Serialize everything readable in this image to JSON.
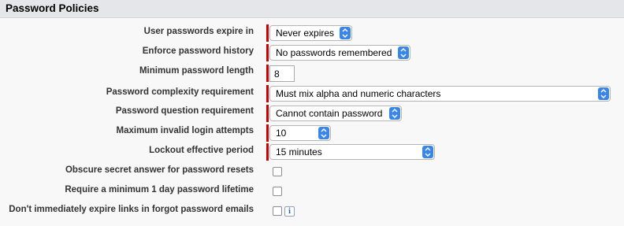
{
  "section": {
    "title": "Password Policies"
  },
  "fields": {
    "expire": {
      "label": "User passwords expire in",
      "value": "Never expires"
    },
    "history": {
      "label": "Enforce password history",
      "value": "No passwords remembered"
    },
    "min_length": {
      "label": "Minimum password length",
      "value": "8"
    },
    "complexity": {
      "label": "Password complexity requirement",
      "value": "Must mix alpha and numeric characters"
    },
    "question": {
      "label": "Password question requirement",
      "value": "Cannot contain password"
    },
    "max_attempts": {
      "label": "Maximum invalid login attempts",
      "value": "10"
    },
    "lockout": {
      "label": "Lockout effective period",
      "value": "15 minutes"
    },
    "obscure": {
      "label": "Obscure secret answer for password resets",
      "checked": false
    },
    "min_lifetime": {
      "label": "Require a minimum 1 day password lifetime",
      "checked": false
    },
    "expire_links": {
      "label": "Don't immediately expire links in forgot password emails",
      "checked": false,
      "info_icon": "info-icon",
      "info_glyph": "i"
    }
  },
  "colors": {
    "required_bar": "#cc0000",
    "select_chevron": "#3a86e8",
    "header_bg": "#e4e6e9",
    "page_bg": "#f8f8f8"
  }
}
